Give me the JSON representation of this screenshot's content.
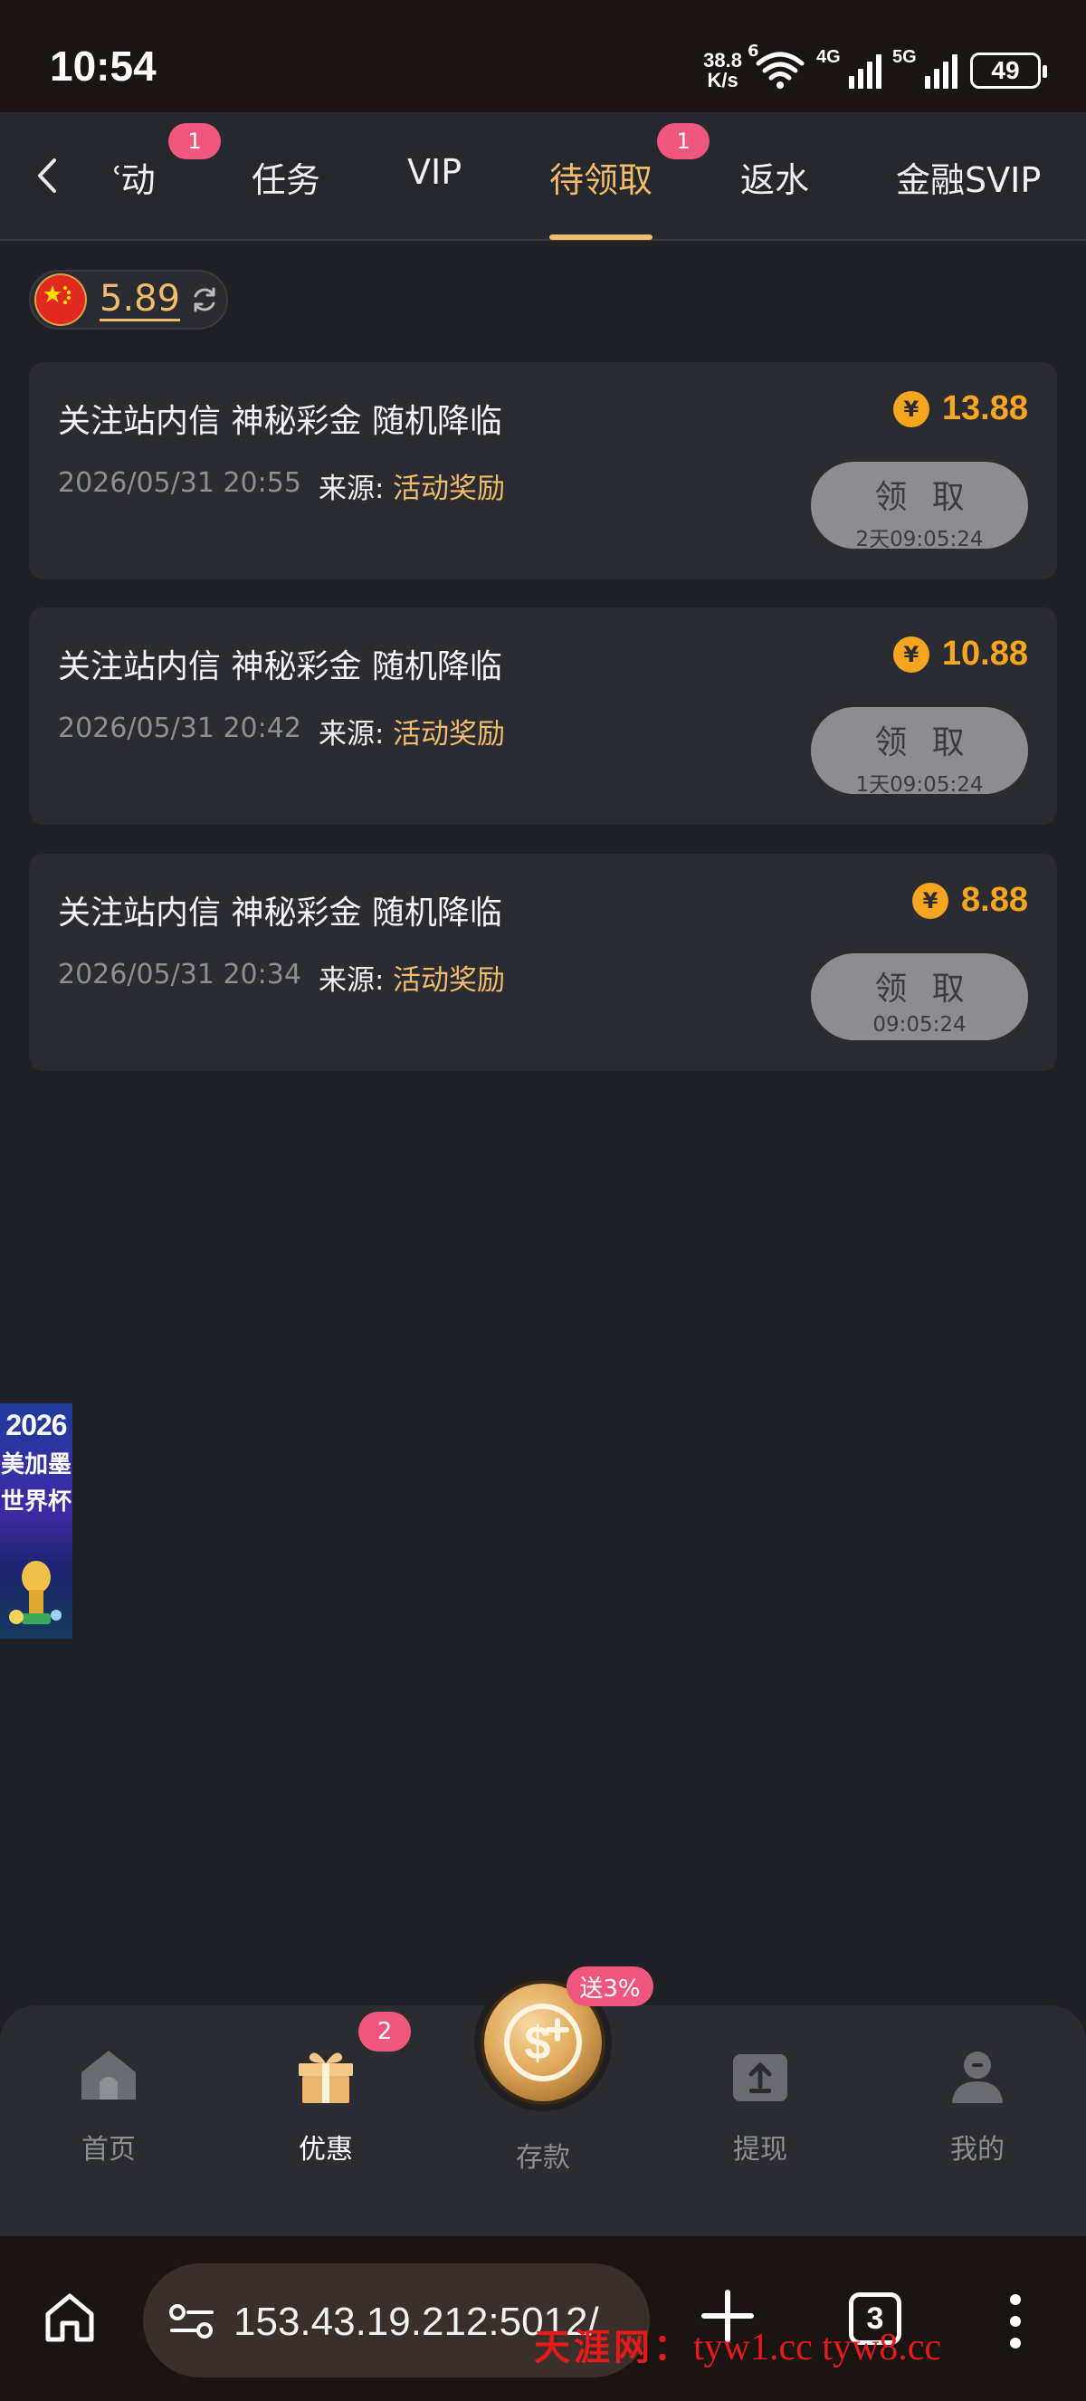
{
  "status_bar": {
    "time": "10:54",
    "net_speed_value": "38.8",
    "net_speed_unit": "K/s",
    "wifi_tag": "6",
    "signal1_tag": "4G",
    "signal2_tag": "5G",
    "battery": "49"
  },
  "nav": {
    "tabs": [
      {
        "label": "动",
        "badge": "1"
      },
      {
        "label": "任务"
      },
      {
        "label": "VIP"
      },
      {
        "label": "待领取",
        "badge": "1",
        "active": true
      },
      {
        "label": "返水"
      },
      {
        "label": "金融SVIP"
      }
    ]
  },
  "balance": {
    "flag": "china-flag-icon",
    "value": "5.89"
  },
  "rewards": [
    {
      "title": "关注站内信 神秘彩金 随机降临",
      "date": "2026/05/31 20:55",
      "source_label": "来源:",
      "source": "活动奖励",
      "currency_symbol": "¥",
      "amount": "13.88",
      "button_label": "领 取",
      "countdown": "2天09:05:24"
    },
    {
      "title": "关注站内信 神秘彩金 随机降临",
      "date": "2026/05/31 20:42",
      "source_label": "来源:",
      "source": "活动奖励",
      "currency_symbol": "¥",
      "amount": "10.88",
      "button_label": "领 取",
      "countdown": "1天09:05:24"
    },
    {
      "title": "关注站内信 神秘彩金 随机降临",
      "date": "2026/05/31 20:34",
      "source_label": "来源:",
      "source": "活动奖励",
      "currency_symbol": "¥",
      "amount": "8.88",
      "button_label": "领 取",
      "countdown": "09:05:24"
    }
  ],
  "promo_banner": {
    "line1": "2026",
    "line2": "美加墨",
    "line3": "世界杯"
  },
  "bottom_nav": {
    "items": [
      {
        "label": "首页",
        "icon": "home-icon"
      },
      {
        "label": "优惠",
        "icon": "gift-icon",
        "badge": "2",
        "active": true
      },
      {
        "label": "存款",
        "icon": "deposit-coin-icon",
        "badge": "送3%"
      },
      {
        "label": "提现",
        "icon": "withdraw-icon"
      },
      {
        "label": "我的",
        "icon": "profile-icon"
      }
    ]
  },
  "browser": {
    "url": "153.43.19.212:5012/",
    "tab_count": "3"
  },
  "watermark": {
    "cn": "天涯网：",
    "url": "tyw1.cc  tyw8.cc"
  },
  "colors": {
    "accent": "#f0bb6c",
    "badge": "#f0577f",
    "amount": "#f5a51f",
    "background": "#202127",
    "card": "#2b2c31"
  }
}
